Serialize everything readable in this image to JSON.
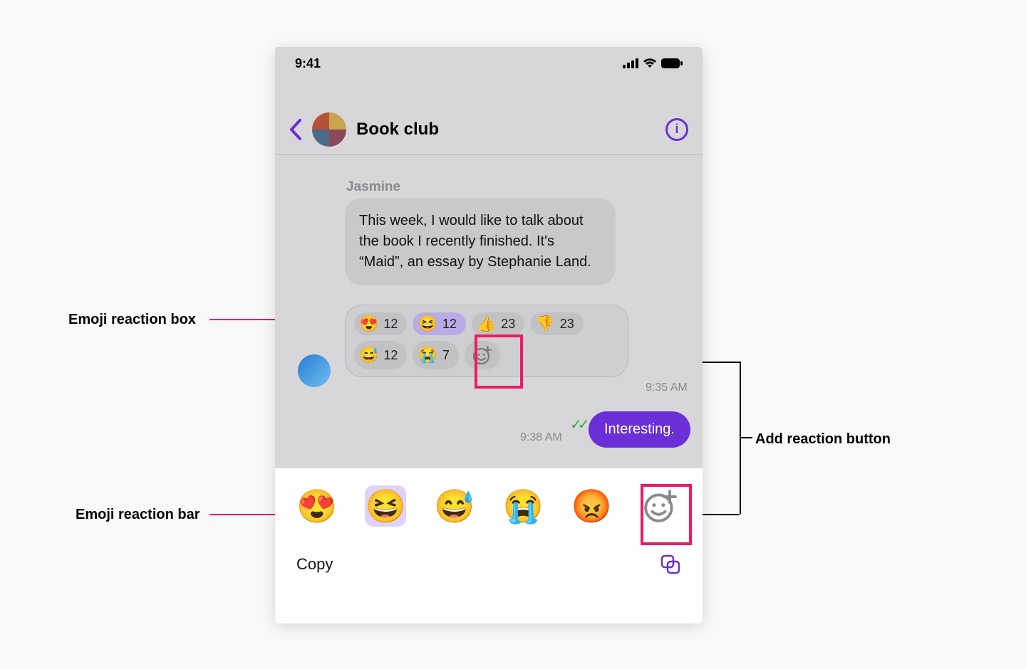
{
  "status": {
    "time": "9:41"
  },
  "header": {
    "title": "Book club"
  },
  "message": {
    "sender": "Jasmine",
    "text": "This week, I would like to talk about the book I recently finished. It's “Maid”, an essay by Stephanie Land.",
    "timestamp": "9:35 AM"
  },
  "reactions": [
    {
      "emoji": "😍",
      "count": 12,
      "selected": false
    },
    {
      "emoji": "😆",
      "count": 12,
      "selected": true
    },
    {
      "emoji": "👍",
      "count": 23,
      "selected": false
    },
    {
      "emoji": "👎",
      "count": 23,
      "selected": false
    },
    {
      "emoji": "😅",
      "count": 12,
      "selected": false
    },
    {
      "emoji": "😭",
      "count": 7,
      "selected": false
    }
  ],
  "reply": {
    "text": "Interesting.",
    "timestamp": "9:38 AM"
  },
  "reaction_bar": {
    "items": [
      {
        "emoji": "😍",
        "selected": false
      },
      {
        "emoji": "😆",
        "selected": true
      },
      {
        "emoji": "😅",
        "selected": false
      },
      {
        "emoji": "😭",
        "selected": false
      },
      {
        "emoji": "😡",
        "selected": false
      }
    ]
  },
  "menu": {
    "copy": "Copy"
  },
  "annotations": {
    "reaction_box": "Emoji reaction box",
    "reaction_bar": "Emoji reaction bar",
    "add_button": "Add reaction button"
  }
}
